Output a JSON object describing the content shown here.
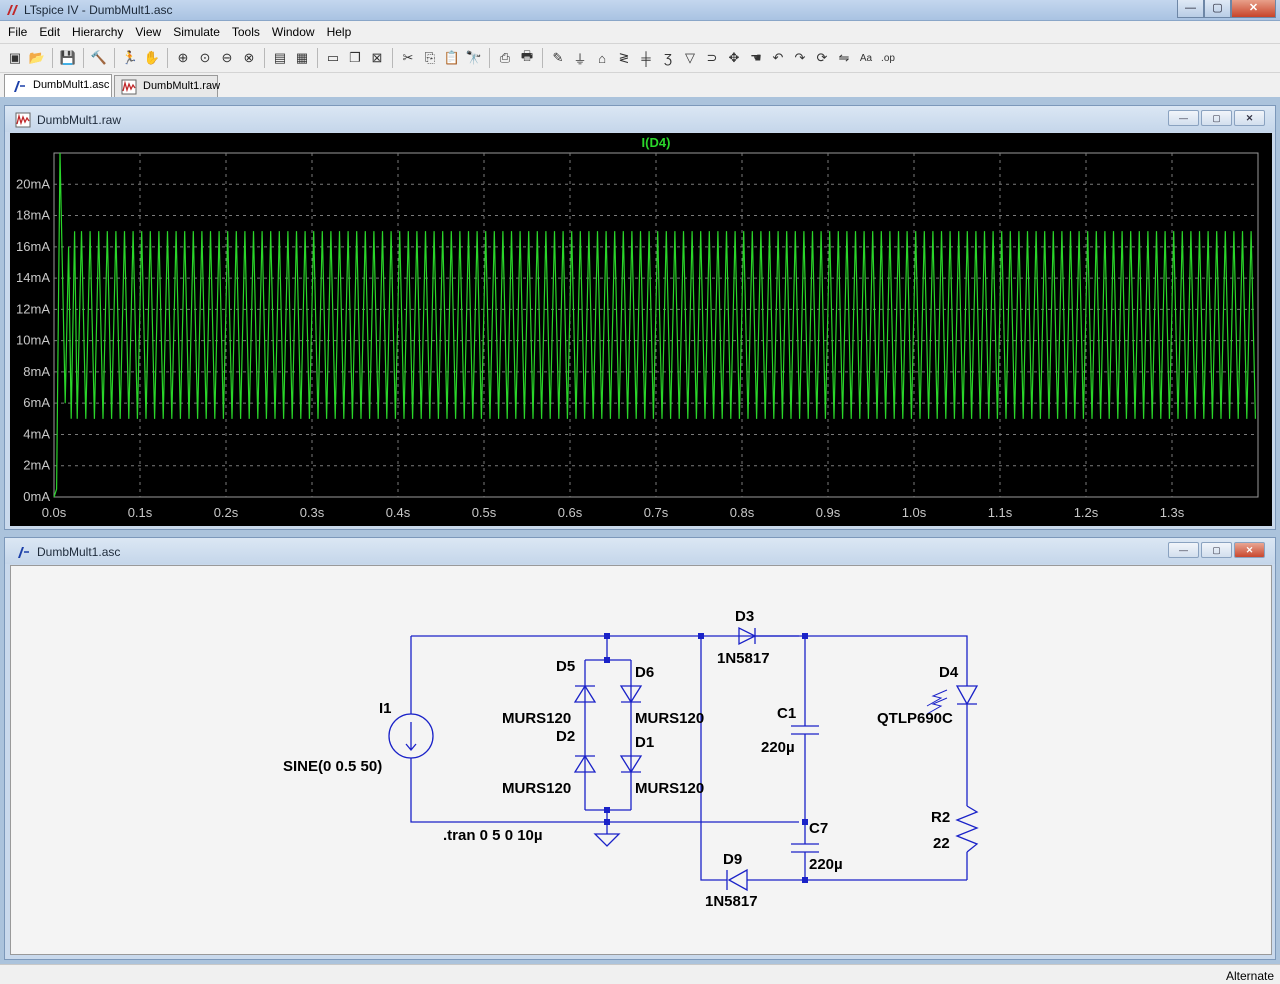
{
  "window": {
    "title": "LTspice IV - DumbMult1.asc",
    "minimize": "—",
    "maximize": "▢",
    "close": "✕"
  },
  "menu": [
    "File",
    "Edit",
    "Hierarchy",
    "View",
    "Simulate",
    "Tools",
    "Window",
    "Help"
  ],
  "toolbar": {
    "groups": [
      [
        "new-schematic-icon",
        "open-icon"
      ],
      [
        "save-icon"
      ],
      [
        "control-panel-icon"
      ],
      [
        "run-icon",
        "halt-icon"
      ],
      [
        "zoom-in-icon",
        "pan-icon",
        "zoom-out-icon",
        "zoom-fit-icon"
      ],
      [
        "autoscale-icon",
        "grid-icon"
      ],
      [
        "tile-horizontal-icon",
        "cascade-icon",
        "close-all-icon"
      ],
      [
        "cut-icon",
        "copy-icon",
        "paste-icon",
        "find-icon"
      ],
      [
        "print-setup-icon",
        "print-icon"
      ],
      [
        "wire-icon",
        "ground-icon",
        "label-net-icon",
        "resistor-icon",
        "capacitor-icon",
        "inductor-icon",
        "diode-icon",
        "component-icon",
        "move-icon",
        "drag-icon",
        "undo-icon",
        "redo-icon",
        "rotate-icon",
        "mirror-icon",
        "text-icon",
        "spice-directive-icon"
      ]
    ],
    "glyphs": {
      "new-schematic-icon": "▣",
      "open-icon": "📂",
      "save-icon": "💾",
      "control-panel-icon": "🔨",
      "run-icon": "🏃",
      "halt-icon": "✋",
      "zoom-in-icon": "⊕",
      "pan-icon": "⊙",
      "zoom-out-icon": "⊖",
      "zoom-fit-icon": "⊗",
      "autoscale-icon": "▤",
      "grid-icon": "▦",
      "tile-horizontal-icon": "▭",
      "cascade-icon": "❐",
      "close-all-icon": "⊠",
      "cut-icon": "✂",
      "copy-icon": "⎘",
      "paste-icon": "📋",
      "find-icon": "🔭",
      "print-setup-icon": "⎙",
      "print-icon": "🖶",
      "wire-icon": "✎",
      "ground-icon": "⏚",
      "label-net-icon": "⌂",
      "resistor-icon": "≷",
      "capacitor-icon": "╪",
      "inductor-icon": "Ʒ",
      "diode-icon": "▽",
      "component-icon": "⊃",
      "move-icon": "✥",
      "drag-icon": "☚",
      "undo-icon": "↶",
      "redo-icon": "↷",
      "rotate-icon": "⟳",
      "mirror-icon": "⇋",
      "text-icon": "Aa",
      "spice-directive-icon": ".op"
    }
  },
  "tabs": [
    {
      "label": "DumbMult1.asc",
      "active": true
    },
    {
      "label": "DumbMult1.raw",
      "active": false
    }
  ],
  "waveform_window": {
    "title": "DumbMult1.raw",
    "trace_label": "I(D4)",
    "trace_color": "#2ad62a"
  },
  "schematic_window": {
    "title": "DumbMult1.asc",
    "wire_color": "#1a22c8",
    "labels": {
      "d3_name": "D3",
      "d3_model": "1N5817",
      "d5_name": "D5",
      "d6_name": "D6",
      "d5_model": "MURS120",
      "d6_model": "MURS120",
      "d2_name": "D2",
      "d1_name": "D1",
      "d2_model": "MURS120",
      "d1_model": "MURS120",
      "i1_name": "I1",
      "i1_value": "SINE(0 0.5 50)",
      "c1_name": "C1",
      "c1_value": "220µ",
      "c7_name": "C7",
      "c7_value": "220µ",
      "d4_name": "D4",
      "d4_model": "QTLP690C",
      "r2_name": "R2",
      "r2_value": "22",
      "d9_name": "D9",
      "d9_model": "1N5817",
      "directive": ".tran 0 5 0 10µ"
    }
  },
  "status": "Alternate",
  "chart_data": {
    "type": "line",
    "title": "I(D4)",
    "xlabel": "",
    "ylabel": "",
    "x_unit": "s",
    "y_unit": "mA",
    "xlim": [
      0,
      1.4
    ],
    "ylim": [
      0,
      22
    ],
    "x_ticks": [
      "0.0s",
      "0.1s",
      "0.2s",
      "0.3s",
      "0.4s",
      "0.5s",
      "0.6s",
      "0.7s",
      "0.8s",
      "0.9s",
      "1.0s",
      "1.1s",
      "1.2s",
      "1.3s"
    ],
    "y_ticks": [
      "0mA",
      "2mA",
      "4mA",
      "6mA",
      "8mA",
      "10mA",
      "12mA",
      "14mA",
      "16mA",
      "18mA",
      "20mA"
    ],
    "grid": true,
    "series": [
      {
        "name": "I(D4)",
        "x": [
          0,
          0.003,
          0.007,
          0.01,
          0.013,
          0.017,
          0.02,
          0.024,
          0.027
        ],
        "y": [
          0,
          0.5,
          22,
          14,
          6,
          16,
          5,
          17,
          5
        ],
        "steady_state": {
          "start": 0.027,
          "end": 1.4,
          "min": 5,
          "max": 17,
          "frequency_hz": 100
        }
      }
    ]
  }
}
